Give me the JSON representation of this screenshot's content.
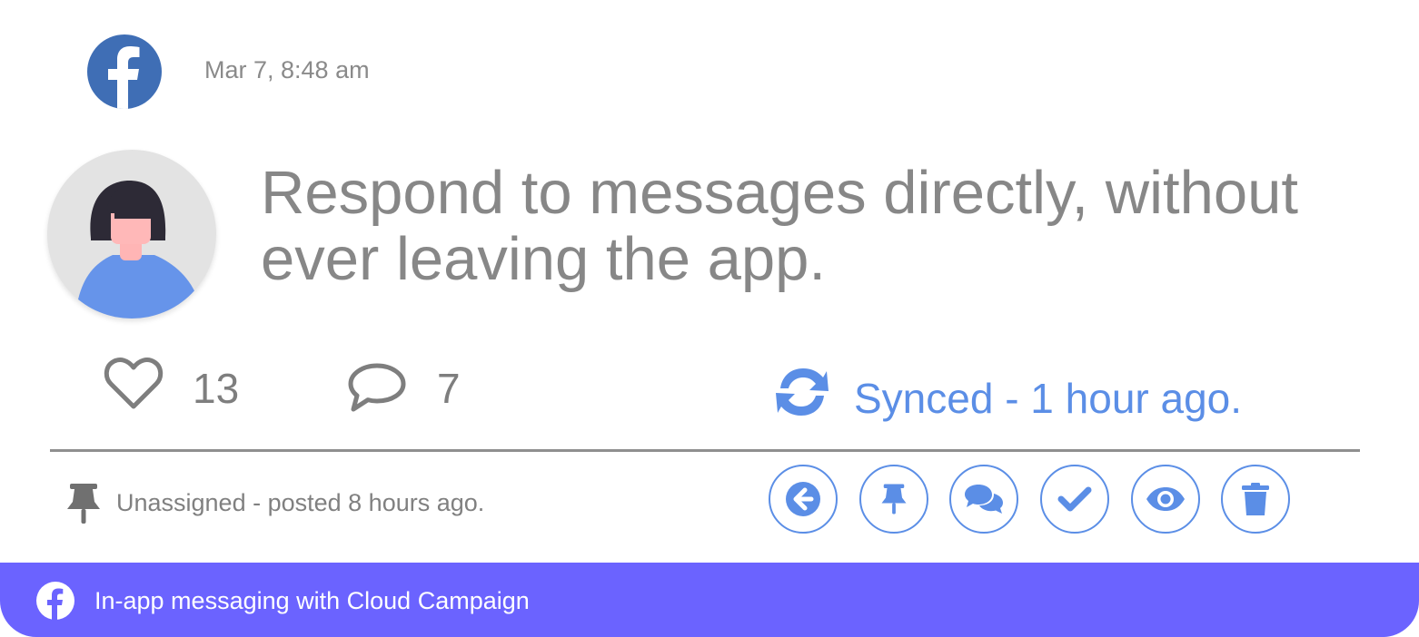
{
  "post": {
    "network_icon": "facebook-icon",
    "timestamp": "Mar 7, 8:48 am",
    "author_avatar": "avatar-woman",
    "message": "Respond to messages directly, without ever leaving the app."
  },
  "stats": {
    "likes": {
      "icon": "heart-icon",
      "count": "13"
    },
    "comments": {
      "icon": "comment-icon",
      "count": "7"
    },
    "sync": {
      "icon": "sync-icon",
      "text": "Synced - 1 hour ago."
    }
  },
  "assignment": {
    "icon": "pin-icon",
    "text": "Unassigned - posted 8 hours ago."
  },
  "actions": [
    {
      "name": "back",
      "icon": "arrow-left-circle-icon"
    },
    {
      "name": "pin",
      "icon": "pin-icon"
    },
    {
      "name": "reply",
      "icon": "comments-icon"
    },
    {
      "name": "complete",
      "icon": "checkmark-icon"
    },
    {
      "name": "view",
      "icon": "eye-icon"
    },
    {
      "name": "delete",
      "icon": "trash-icon"
    }
  ],
  "footer": {
    "icon": "facebook-icon",
    "text": "In-app messaging with Cloud Campaign"
  },
  "colors": {
    "facebook": "#3f6eb5",
    "accent": "#5b8ee6",
    "footer_bg": "#6b63ff",
    "muted_text": "#878787"
  }
}
